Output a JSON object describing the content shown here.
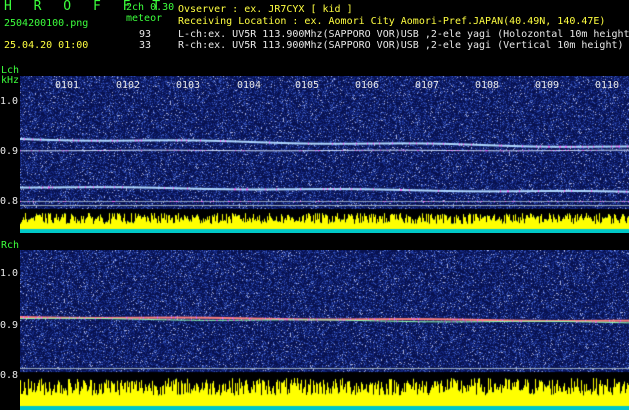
{
  "app": {
    "title": "H R O F F T",
    "version": "2ch 0.30"
  },
  "file": {
    "name": "2504200100.png",
    "datetime": "25.04.20 01:00"
  },
  "meteor": {
    "label": "meteor",
    "lch_count": "93",
    "rch_count": "33"
  },
  "header": {
    "observer": "Ovserver                 : ex. JR7CYX [ kid ]",
    "location": "Receiving Location : ex. Aomori City Aomori-Pref.JAPAN(40.49N, 140.47E)",
    "lch_info": "L-ch:ex. UV5R 113.900Mhz(SAPPORO VOR)USB ,2-ele yagi (Holozontal 10m height)",
    "rch_info": "R-ch:ex. UV5R 113.900Mhz(SAPPORO VOR)USB ,2-ele yagi (Vertical 10m height)"
  },
  "lch": {
    "label": "Lch",
    "unit": "kHz",
    "yticks": [
      "1.0",
      "0.9",
      "0.8"
    ],
    "xticks": [
      "0101",
      "0102",
      "0103",
      "0104",
      "0105",
      "0106",
      "0107",
      "0108",
      "0109",
      "0110"
    ]
  },
  "rch": {
    "label": "Rch",
    "yticks": [
      "1.0",
      "0.9",
      "0.8"
    ]
  },
  "colors": {
    "background": "#000000",
    "label": "#3cff3c",
    "count": "#ffff40",
    "spectrum": "#0a1a66",
    "histogram": "#ffff00",
    "histogram_base": "#00c8c8"
  }
}
